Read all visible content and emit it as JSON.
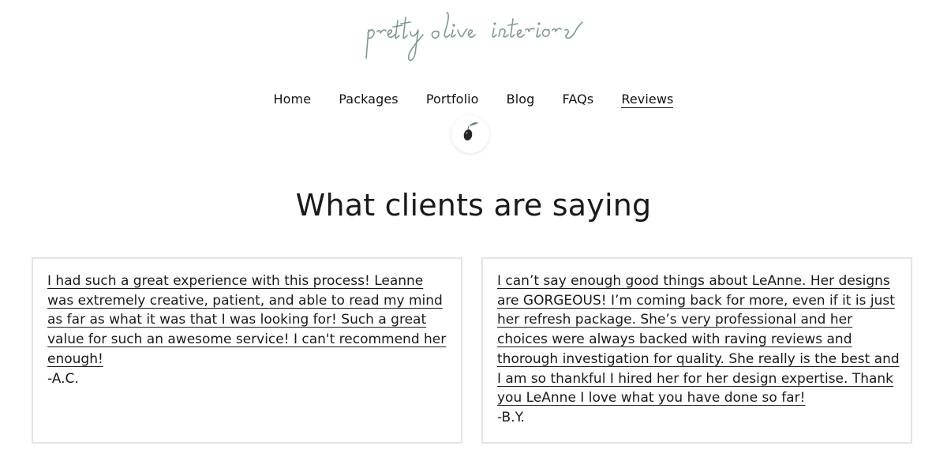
{
  "brand": {
    "logo_text": "pretty olive interiors",
    "logo_color": "#7f9b8e"
  },
  "nav": {
    "items": [
      {
        "label": "Home",
        "active": false
      },
      {
        "label": "Packages",
        "active": false
      },
      {
        "label": "Portfolio",
        "active": false
      },
      {
        "label": "Blog",
        "active": false
      },
      {
        "label": "FAQs",
        "active": false
      },
      {
        "label": "Reviews",
        "active": true
      }
    ]
  },
  "badge": {
    "icon": "olive-icon"
  },
  "page": {
    "heading": "What clients are saying"
  },
  "reviews": [
    {
      "text": "I had such a great experience with this process! Leanne was extremely creative, patient, and able to read my mind as far as what it was that I was looking for! Such a great value for such an awesome service! I can't recommend her enough!",
      "author": "-A.C."
    },
    {
      "text": "I can’t say enough good things about LeAnne. Her designs are GORGEOUS! I’m coming back for more, even if it is just her refresh package. She’s very professional and her choices were always backed with raving reviews and thorough investigation for quality. She really is the best and I am so thankful I hired her for her design expertise. Thank you LeAnne I love what you have done so far!",
      "author": "-B.Y."
    }
  ],
  "colors": {
    "text": "#1a1a1a",
    "card_border": "#e4e4e4",
    "olive": "#2b2b2b",
    "leaf": "#5f8a72"
  }
}
